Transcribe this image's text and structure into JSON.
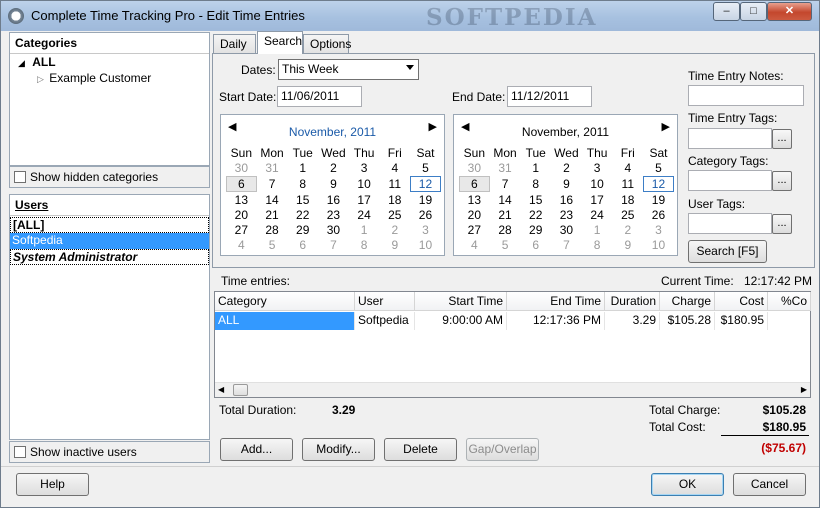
{
  "window": {
    "title": "Complete Time Tracking Pro - Edit Time Entries",
    "watermark": "SOFTPEDIA",
    "controls": {
      "minimize": "–",
      "maximize": "□",
      "close": "✕"
    }
  },
  "categories": {
    "header": "Categories",
    "tree": [
      {
        "label": "ALL",
        "expanded": true
      },
      {
        "label": "Example Customer"
      }
    ],
    "show_hidden_label": "Show hidden categories"
  },
  "users": {
    "header": "Users",
    "items": [
      "[ALL]",
      "Softpedia",
      "System Administrator"
    ],
    "selected_index": 1,
    "show_inactive_label": "Show inactive users"
  },
  "tabs": [
    "Daily",
    "Search",
    "Options"
  ],
  "active_tab": 1,
  "search": {
    "dates_label": "Dates:",
    "dates_value": "This Week",
    "start_label": "Start Date:",
    "start_value": "11/06/2011",
    "end_label": "End Date:",
    "end_value": "11/12/2011",
    "notes_label": "Time Entry Notes:",
    "notes_value": "",
    "tags_label": "Time Entry Tags:",
    "tags_value": "",
    "cat_tags_label": "Category Tags:",
    "cat_tags_value": "",
    "user_tags_label": "User Tags:",
    "user_tags_value": "",
    "browse_label": "...",
    "search_button": "Search [F5]",
    "calendars": [
      {
        "month": "November, 2011",
        "month_color": "#1a5aa8",
        "selected_day": "6",
        "today": "12"
      },
      {
        "month": "November, 2011",
        "month_color": "#000000",
        "selected_day": "6",
        "today": "12"
      }
    ],
    "weekdays": [
      "Sun",
      "Mon",
      "Tue",
      "Wed",
      "Thu",
      "Fri",
      "Sat"
    ],
    "weeks": [
      [
        "30",
        "31",
        "1",
        "2",
        "3",
        "4",
        "5"
      ],
      [
        "6",
        "7",
        "8",
        "9",
        "10",
        "11",
        "12"
      ],
      [
        "13",
        "14",
        "15",
        "16",
        "17",
        "18",
        "19"
      ],
      [
        "20",
        "21",
        "22",
        "23",
        "24",
        "25",
        "26"
      ],
      [
        "27",
        "28",
        "29",
        "30",
        "1",
        "2",
        "3"
      ],
      [
        "4",
        "5",
        "6",
        "7",
        "8",
        "9",
        "10"
      ]
    ]
  },
  "entries": {
    "label": "Time entries:",
    "current_time_label": "Current Time:",
    "current_time_value": "12:17:42 PM",
    "columns": [
      "Category",
      "User",
      "Start Time",
      "End Time",
      "Duration",
      "Charge",
      "Cost",
      "%Co"
    ],
    "rows": [
      [
        "ALL",
        "Softpedia",
        "9:00:00 AM",
        "12:17:36 PM",
        "3.29",
        "$105.28",
        "$180.95",
        ""
      ]
    ]
  },
  "totals": {
    "duration_label": "Total Duration:",
    "duration_value": "3.29",
    "charge_label": "Total Charge:",
    "charge_value": "$105.28",
    "cost_label": "Total Cost:",
    "cost_value": "$180.95",
    "difference_value": "($75.67)",
    "difference_color": "#c00000"
  },
  "actions": {
    "add": "Add...",
    "modify": "Modify...",
    "delete": "Delete",
    "gap": "Gap/Overlap"
  },
  "footer": {
    "help": "Help",
    "ok": "OK",
    "cancel": "Cancel"
  }
}
